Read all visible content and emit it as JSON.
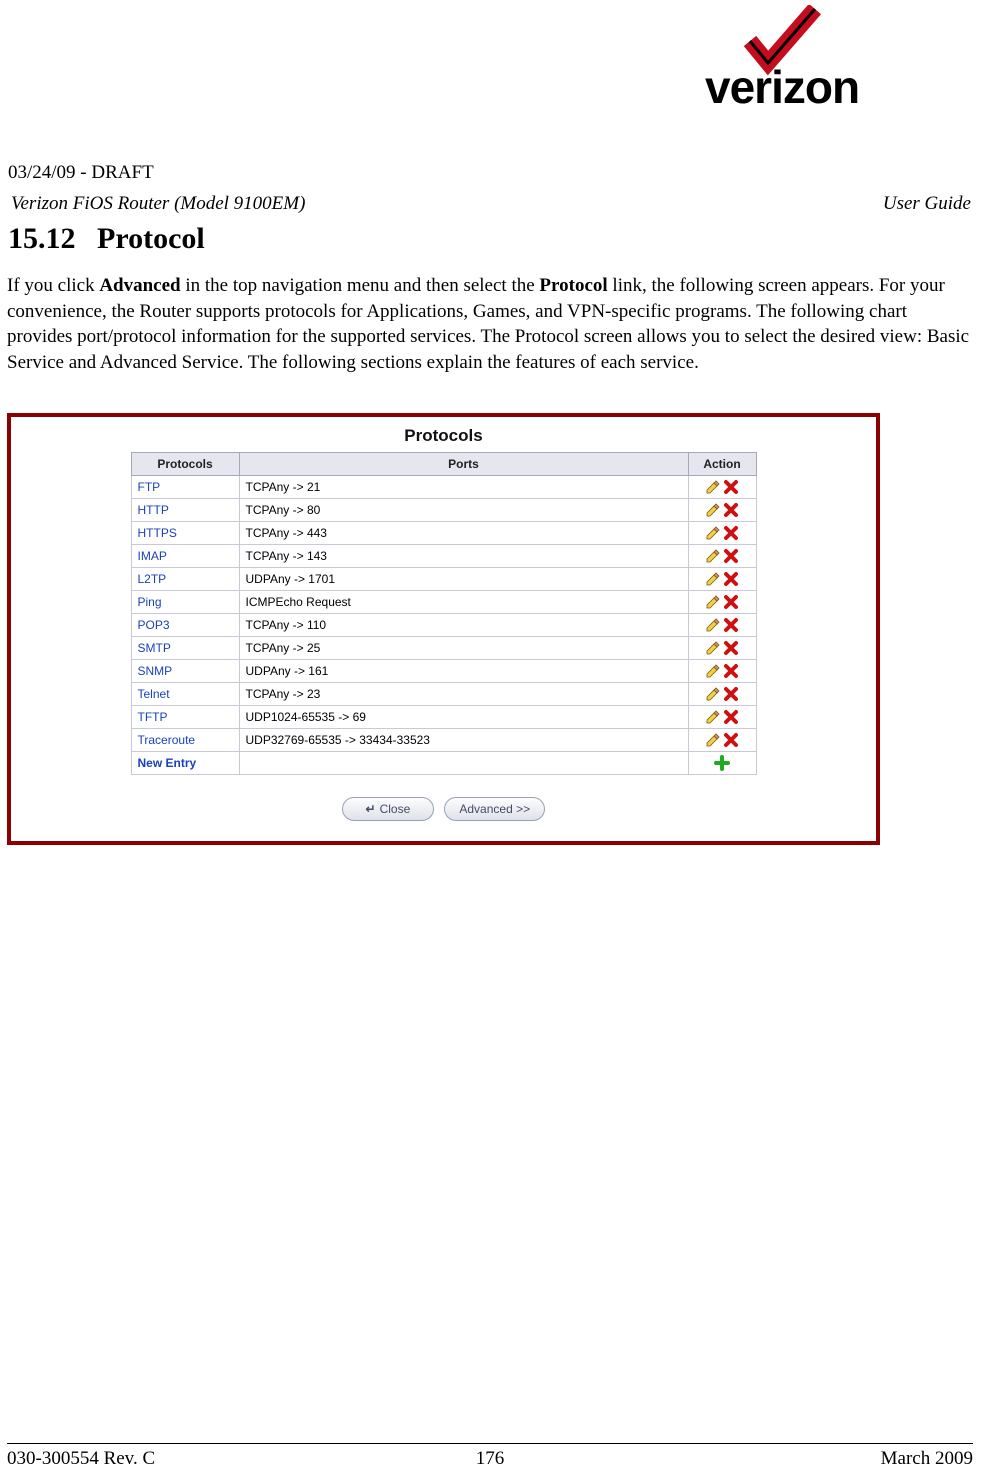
{
  "meta": {
    "draft": "03/24/09 - DRAFT",
    "product": "Verizon FiOS Router (Model 9100EM)",
    "doc_type": "User Guide",
    "logo_text": "verizon"
  },
  "section": {
    "number": "15.12",
    "title": "Protocol"
  },
  "body": {
    "p1_a": "If you click ",
    "p1_b": "Advanced",
    "p1_c": " in the top navigation menu and then select the ",
    "p1_d": "Protocol",
    "p1_e": " link, the following screen appears. For your convenience, the Router supports protocols for Applications, Games, and VPN-specific programs. The following chart provides port/protocol information for the supported services. The Protocol screen allows you to select the desired view: Basic Service and Advanced Service. The following sections explain the features of each service."
  },
  "panel": {
    "title": "Protocols",
    "columns": {
      "protocols": "Protocols",
      "ports": "Ports",
      "action": "Action"
    },
    "buttons": {
      "close": "Close",
      "advanced": "Advanced >>"
    },
    "new_entry_label": "New Entry",
    "rows": [
      {
        "name": "FTP",
        "ports": "TCPAny -> 21"
      },
      {
        "name": "HTTP",
        "ports": "TCPAny -> 80"
      },
      {
        "name": "HTTPS",
        "ports": "TCPAny -> 443"
      },
      {
        "name": "IMAP",
        "ports": "TCPAny -> 143"
      },
      {
        "name": "L2TP",
        "ports": "UDPAny -> 1701"
      },
      {
        "name": "Ping",
        "ports": "ICMPEcho Request"
      },
      {
        "name": "POP3",
        "ports": "TCPAny -> 110"
      },
      {
        "name": "SMTP",
        "ports": "TCPAny -> 25"
      },
      {
        "name": "SNMP",
        "ports": "UDPAny -> 161"
      },
      {
        "name": "Telnet",
        "ports": "TCPAny -> 23"
      },
      {
        "name": "TFTP",
        "ports": "UDP1024-65535 -> 69"
      },
      {
        "name": "Traceroute",
        "ports": "UDP32769-65535 -> 33434-33523"
      }
    ]
  },
  "footer": {
    "left": "030-300554 Rev. C",
    "center": "176",
    "right": "March 2009"
  }
}
